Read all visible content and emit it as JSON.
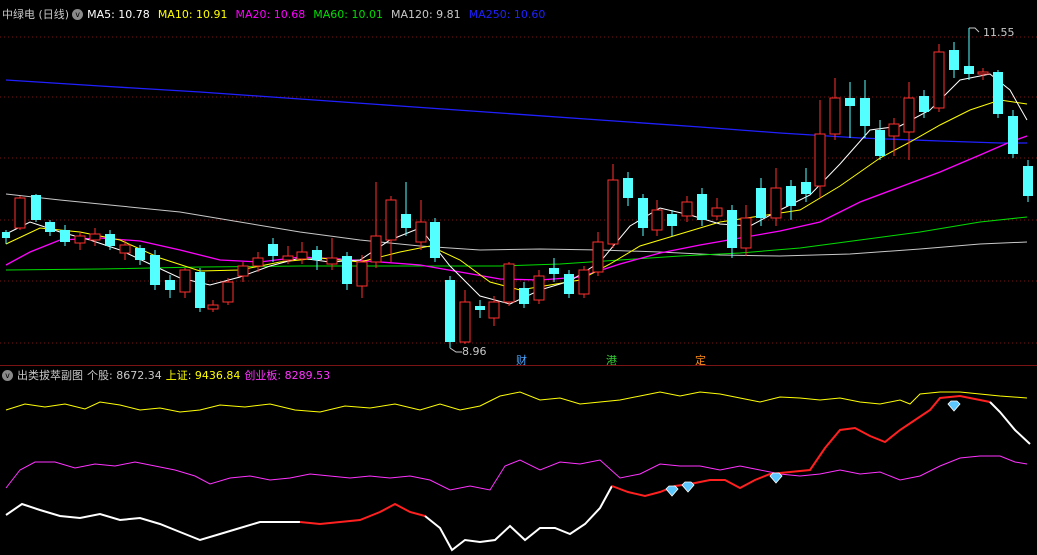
{
  "main_chart": {
    "stock_label": "中绿电 (日线)",
    "ma": [
      {
        "label": "MA5: 10.78",
        "color": "#ffffff"
      },
      {
        "label": "MA10: 10.91",
        "color": "#ffff00"
      },
      {
        "label": "MA20: 10.68",
        "color": "#ff00ff"
      },
      {
        "label": "MA60: 10.01",
        "color": "#00dd00"
      },
      {
        "label": "MA120: 9.81",
        "color": "#c8c8c8"
      },
      {
        "label": "MA250: 10.60",
        "color": "#2020ff"
      }
    ],
    "high_label": "11.55",
    "low_label": "8.96",
    "event_tags": [
      {
        "text": "财",
        "color": "#4da6ff"
      },
      {
        "text": "港",
        "color": "#33cc33"
      },
      {
        "text": "定",
        "color": "#ff8c1a"
      }
    ],
    "colors": {
      "up": "#ff3030",
      "down": "#54ffff",
      "grid": "#7a1414",
      "background": "#000000"
    }
  },
  "sub_chart": {
    "title": "出类拔萃副图",
    "items": [
      {
        "label": "个股: 8672.34",
        "color": "#c8c8c8"
      },
      {
        "label": "上证: 9436.84",
        "color": "#ffff00"
      },
      {
        "label": "创业板: 8289.53",
        "color": "#ff33ff"
      }
    ],
    "icons": [
      "diamond-icon",
      "diamond-icon",
      "diamond-icon",
      "diamond-icon"
    ]
  }
}
